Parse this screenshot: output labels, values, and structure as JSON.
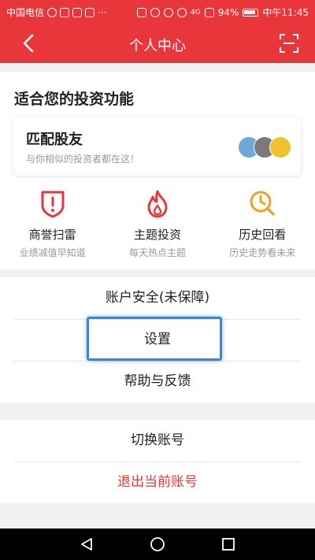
{
  "status_bar": {
    "carrier": "中国电信",
    "dots": "···",
    "signal": "4G",
    "battery": "94%",
    "time": "中午11:45"
  },
  "header": {
    "title": "个人中心"
  },
  "invest_section": {
    "title": "适合您的投资功能",
    "card": {
      "title": "匹配股友",
      "subtitle": "与你相似的投资者都在这！"
    },
    "features": [
      {
        "label": "商誉扫雷",
        "subtitle": "业绩减值早知道",
        "color": "#e8363b",
        "icon": "shield-alert-icon"
      },
      {
        "label": "主题投资",
        "subtitle": "每天热点主题",
        "color": "#e8363b",
        "icon": "flame-icon"
      },
      {
        "label": "历史回看",
        "subtitle": "历史走势看未来",
        "color": "#f0a025",
        "icon": "clock-search-icon"
      }
    ]
  },
  "menu": {
    "account_security": "账户安全(未保障)",
    "settings": "设置",
    "help_feedback": "帮助与反馈",
    "switch_account": "切换账号",
    "logout": "退出当前账号"
  },
  "colors": {
    "brand_red": "#e8363b",
    "highlight_blue": "#3d84d6"
  }
}
